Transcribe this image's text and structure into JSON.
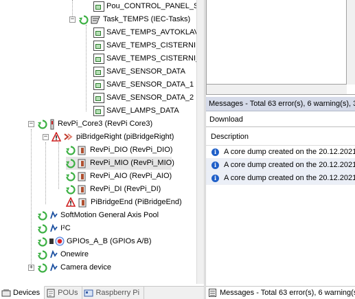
{
  "tree": {
    "items": [
      {
        "label": "Pou_CONTROL_PANEL_S"
      },
      {
        "label": "Task_TEMPS (IEC-Tasks)"
      },
      {
        "label": "SAVE_TEMPS_AVTOKLAV"
      },
      {
        "label": "SAVE_TEMPS_CISTERNI"
      },
      {
        "label": "SAVE_TEMPS_CISTERNI_"
      },
      {
        "label": "SAVE_SENSOR_DATA"
      },
      {
        "label": "SAVE_SENSOR_DATA_1"
      },
      {
        "label": "SAVE_SENSOR_DATA_2"
      },
      {
        "label": "SAVE_LAMPS_DATA"
      },
      {
        "label": "RevPi_Core3 (RevPi Core3)"
      },
      {
        "label": "piBridgeRight (piBridgeRight)"
      },
      {
        "label": "RevPi_DIO (RevPi_DIO)"
      },
      {
        "label": "RevPi_MIO (RevPi_MIO)"
      },
      {
        "label": "RevPi_AIO (RevPi_AIO)"
      },
      {
        "label": "RevPi_DI (RevPi_DI)"
      },
      {
        "label": "PiBridgeEnd (PiBridgeEnd)"
      },
      {
        "label": "SoftMotion General Axis Pool"
      },
      {
        "label": "I²C"
      },
      {
        "label": "GPIOs_A_B (GPIOs A/B)"
      },
      {
        "label": "Onewire"
      },
      {
        "label": "Camera device"
      }
    ],
    "expanders": {
      "open": "−",
      "closed": "+"
    }
  },
  "bottom_tabs": [
    {
      "label": "Devices"
    },
    {
      "label": "POUs"
    },
    {
      "label": "Raspberry Pi"
    }
  ],
  "messages": {
    "title": "Messages - Total 63 error(s), 6 warning(s), 3",
    "toolbar_label": "Download",
    "column_header": "Description",
    "info_glyph": "i",
    "rows": [
      {
        "text": "A core dump created on the 20.12.2021"
      },
      {
        "text": "A core dump created on the 20.12.2021"
      },
      {
        "text": "A core dump created on the 20.12.2021"
      }
    ],
    "bottom_tab_label": "Messages - Total 63 error(s), 6 warning(s"
  },
  "colors": {
    "accent_run": "#3cb043",
    "info": "#1f5fc8",
    "error": "#d02020",
    "title_bar": "#d6dbe9"
  }
}
